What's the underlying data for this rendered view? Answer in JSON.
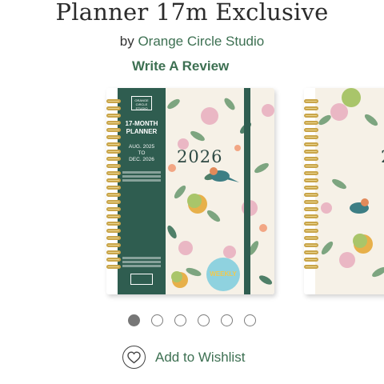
{
  "product": {
    "title": "Planner 17m Exclusive",
    "by_label": "by",
    "author": "Orange Circle Studio",
    "review_label": "Write A Review"
  },
  "planner": {
    "brand_logo": "ORANGE CIRCLE STUDIO",
    "month_label": "17-MONTH\nPLANNER",
    "range": "AUG. 2025\nTO\nDEC. 2026",
    "year": "2026",
    "badge": "WEEKLY"
  },
  "gallery": {
    "slide_count": 6,
    "active_index": 0
  },
  "wishlist": {
    "label": "Add to Wishlist",
    "icon": "heart-icon"
  },
  "colors": {
    "accent_green": "#3d7052",
    "band_green": "#2f5d50",
    "badge_blue": "#8fd2df"
  }
}
